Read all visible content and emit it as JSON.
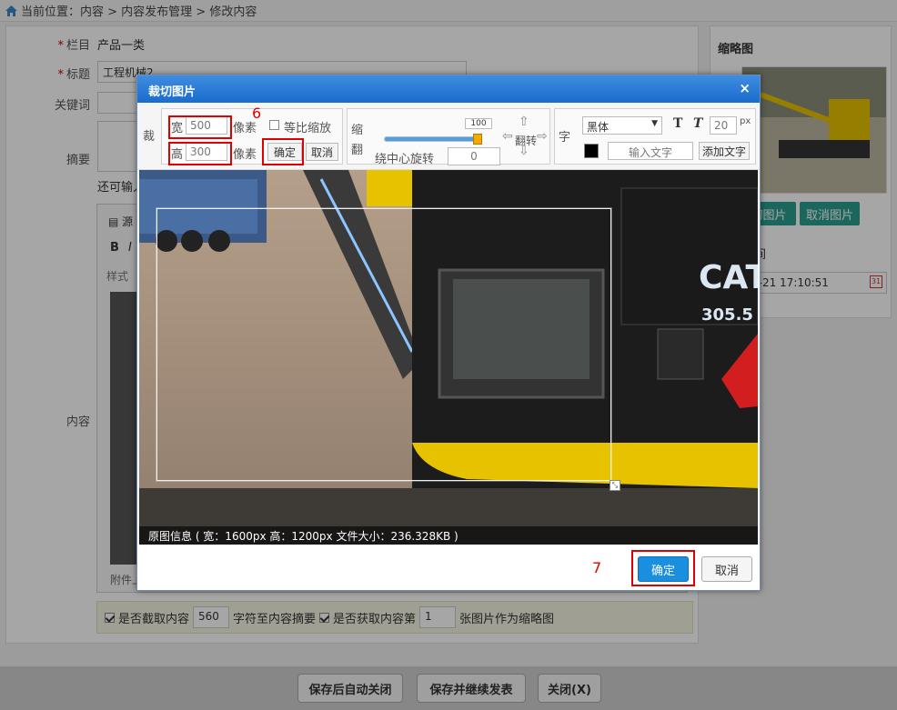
{
  "breadcrumb": {
    "text": "当前位置：内容 > 内容发布管理 > 修改内容"
  },
  "form": {
    "column_label": "栏目",
    "column_value": "产品一类",
    "title_label": "标题",
    "title_value": "工程机械2",
    "keywords_label": "关键词",
    "summary_label": "摘要",
    "summary_hint": "还可输入",
    "content_label": "内容",
    "editor_tab": "源",
    "editor_bold": "B",
    "editor_italic": "I",
    "editor_style": "样式",
    "attachment_label": "附件上",
    "opt_extract_label": "是否截取内容",
    "opt_extract_value": "560",
    "opt_extract_suffix": "字符至内容摘要",
    "opt_thumb_label": "是否获取内容第",
    "opt_thumb_value": "1",
    "opt_thumb_suffix": "张图片作为缩略图"
  },
  "right_panel": {
    "title": "缩略图",
    "crop_btn": "切图片",
    "cancel_btn": "取消图片",
    "time_label": "间",
    "time_value": "2-21 17:10:51"
  },
  "bottom_bar": {
    "btn_save_close": "保存后自动关闭",
    "btn_save_continue": "保存并继续发表",
    "btn_close": "关闭(X)"
  },
  "dialog": {
    "title": "裁切图片",
    "close": "×",
    "crop_group_label": "裁",
    "width_label": "宽",
    "width_value": "500",
    "width_unit": "像素",
    "height_label": "高",
    "height_value": "300",
    "height_unit": "像素",
    "proportional_label": "等比缩放",
    "confirm_btn": "确定",
    "cancel_btn": "取消",
    "scale_group_label_1": "缩",
    "scale_group_label_2": "翻",
    "slider_value": "100",
    "rotate_label": "绕中心旋转",
    "rotate_value": "0",
    "flip_label": "翻转",
    "text_group_label": "字",
    "font_value": "黑体",
    "bold_btn": "T",
    "italic_btn": "T",
    "font_size_value": "20",
    "font_size_unit": "px",
    "text_placeholder": "输入文字",
    "add_text_btn": "添加文字",
    "info_text": "原图信息 ( 宽：1600px  高：1200px  文件大小：236.328KB )",
    "footer_confirm": "确定",
    "footer_cancel": "取消",
    "annotation_6": "6",
    "annotation_7": "7"
  },
  "slider": {
    "level_fraction": 1.0
  },
  "colors": {
    "accent_blue": "#1a8fe0",
    "title_bar": "#2a7bd8",
    "annotation_red": "#e00000",
    "thumb_btn_green": "#2a9d8f"
  }
}
